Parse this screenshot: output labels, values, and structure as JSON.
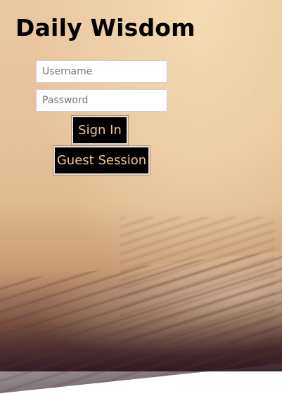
{
  "app": {
    "title": "Daily Wisdom"
  },
  "login": {
    "username_placeholder": "Username",
    "password_placeholder": "Password",
    "signin_label": "Sign In",
    "guest_label": "Guest Session"
  },
  "colors": {
    "button_bg": "#000000",
    "button_text": "#f0c68f"
  }
}
